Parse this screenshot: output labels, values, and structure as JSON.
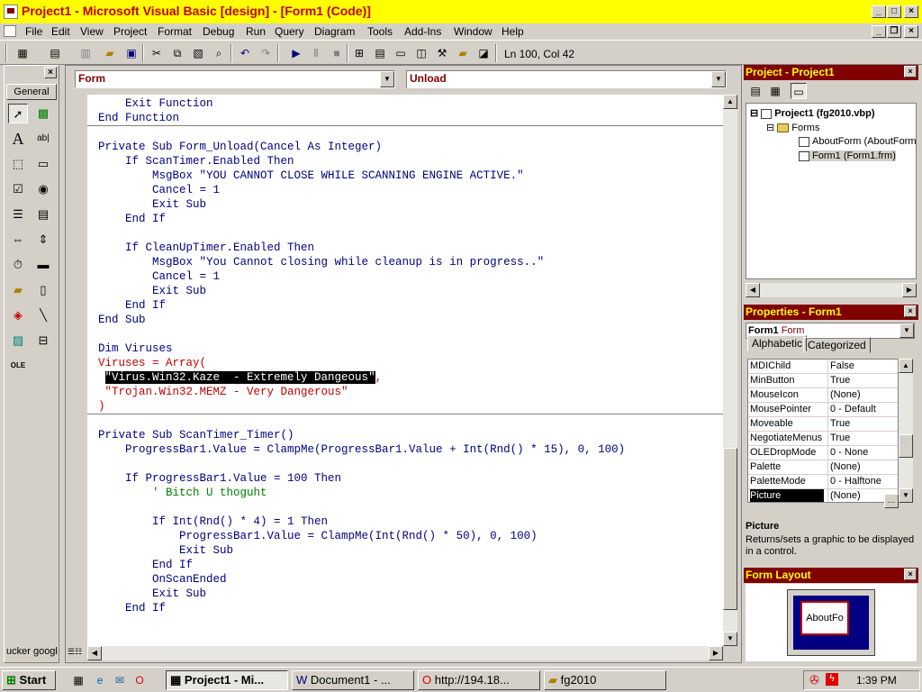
{
  "window": {
    "title": "Project1 - Microsoft Visual Basic [design] - [Form1 (Code)]",
    "title_color": "#ffff00",
    "title_text_color": "#c00000"
  },
  "menu": [
    {
      "label": "File"
    },
    {
      "label": "Edit"
    },
    {
      "label": "View"
    },
    {
      "label": "Project"
    },
    {
      "label": "Format"
    },
    {
      "label": "Debug"
    },
    {
      "label": "Run"
    },
    {
      "label": "Query"
    },
    {
      "label": "Diagram"
    },
    {
      "label": "Tools"
    },
    {
      "label": "Add-Ins"
    },
    {
      "label": "Window"
    },
    {
      "label": "Help"
    }
  ],
  "toolbar": {
    "status": "Ln 100, Col 42",
    "icons": [
      "add-project-icon",
      "add-form-icon",
      "menu-editor-icon",
      "open-icon",
      "save-icon",
      "cut-icon",
      "copy-icon",
      "paste-icon",
      "find-icon",
      "undo-icon",
      "redo-icon",
      "run-icon",
      "pause-icon",
      "stop-icon",
      "project-explorer-icon",
      "properties-icon",
      "form-layout-icon",
      "object-browser-icon",
      "toolbox-icon",
      "data-view-icon",
      "component-manager-icon"
    ]
  },
  "toolbox": {
    "tab_label": "General",
    "bottom_text": "ucker googl"
  },
  "code": {
    "object_combo": "Form",
    "procedure_combo": "Unload",
    "lines": [
      {
        "text": "    Exit Function",
        "style": "k"
      },
      {
        "text": "End Function",
        "style": "k"
      },
      {
        "text": "",
        "style": "k"
      },
      {
        "text": "Private Sub Form_Unload(Cancel As Integer)",
        "style": "k"
      },
      {
        "text": "    If ScanTimer.Enabled Then",
        "style": "k"
      },
      {
        "text": "        MsgBox \"YOU CANNOT CLOSE WHILE SCANNING ENGINE ACTIVE.\"",
        "style": "k"
      },
      {
        "text": "        Cancel = 1",
        "style": "k"
      },
      {
        "text": "        Exit Sub",
        "style": "k"
      },
      {
        "text": "    End If",
        "style": "k"
      },
      {
        "text": "",
        "style": "k"
      },
      {
        "text": "    If CleanUpTimer.Enabled Then",
        "style": "k"
      },
      {
        "text": "        MsgBox \"You Cannot closing while cleanup is in progress..\"",
        "style": "k"
      },
      {
        "text": "        Cancel = 1",
        "style": "k"
      },
      {
        "text": "        Exit Sub",
        "style": "k"
      },
      {
        "text": "    End If",
        "style": "k"
      },
      {
        "text": "End Sub",
        "style": "k"
      },
      {
        "text": "",
        "style": "k"
      },
      {
        "text": "Dim Viruses",
        "style": "k"
      },
      {
        "text": "Viruses = Array(",
        "style": "red"
      },
      {
        "text": " \"Virus.Win32.Kaze  - Extremely Dangeous\",",
        "style": "red",
        "selected_part": "\"Virus.Win32.Kaze  - Extremely Dangeous\""
      },
      {
        "text": " \"Trojan.Win32.MEMZ - Very Dangerous\"",
        "style": "red"
      },
      {
        "text": ")",
        "style": "red"
      },
      {
        "text": "",
        "style": "k"
      },
      {
        "text": "Private Sub ScanTimer_Timer()",
        "style": "k"
      },
      {
        "text": "    ProgressBar1.Value = ClampMe(ProgressBar1.Value + Int(Rnd() * 15), 0, 100)",
        "style": "k"
      },
      {
        "text": "",
        "style": "k"
      },
      {
        "text": "    If ProgressBar1.Value = 100 Then",
        "style": "k"
      },
      {
        "text": "        ' Bitch U thoguht",
        "style": "green"
      },
      {
        "text": "",
        "style": "k"
      },
      {
        "text": "        If Int(Rnd() * 4) = 1 Then",
        "style": "k"
      },
      {
        "text": "            ProgressBar1.Value = ClampMe(Int(Rnd() * 50), 0, 100)",
        "style": "k"
      },
      {
        "text": "            Exit Sub",
        "style": "k"
      },
      {
        "text": "        End If",
        "style": "k"
      },
      {
        "text": "        OnScanEnded",
        "style": "k"
      },
      {
        "text": "        Exit Sub",
        "style": "k"
      },
      {
        "text": "    End If",
        "style": "k"
      }
    ]
  },
  "project": {
    "header": "Project - Project1",
    "tree": {
      "root": "Project1 (fg2010.vbp)",
      "folder": "Forms",
      "items": [
        "AboutForm (AboutForm",
        "Form1 (Form1.frm)"
      ]
    }
  },
  "properties": {
    "header": "Properties - Form1",
    "object": "Form1",
    "object_type": "Form",
    "tabs": [
      "Alphabetic",
      "Categorized"
    ],
    "rows": [
      {
        "name": "MDIChild",
        "value": "False"
      },
      {
        "name": "MinButton",
        "value": "True"
      },
      {
        "name": "MouseIcon",
        "value": "(None)"
      },
      {
        "name": "MousePointer",
        "value": "0 - Default"
      },
      {
        "name": "Moveable",
        "value": "True"
      },
      {
        "name": "NegotiateMenus",
        "value": "True"
      },
      {
        "name": "OLEDropMode",
        "value": "0 - None"
      },
      {
        "name": "Palette",
        "value": "(None)"
      },
      {
        "name": "PaletteMode",
        "value": "0 - Halftone"
      },
      {
        "name": "Picture",
        "value": "(None)"
      }
    ],
    "selected": "Picture",
    "desc_title": "Picture",
    "desc_text": "Returns/sets a graphic to be displayed in a control."
  },
  "form_layout": {
    "header": "Form Layout",
    "preview_label": "AboutFo"
  },
  "taskbar": {
    "start": "Start",
    "buttons": [
      "Project1 - Mi...",
      "Document1 - ...",
      "http://194.18...",
      "fg2010"
    ],
    "clock": "1:39 PM"
  }
}
